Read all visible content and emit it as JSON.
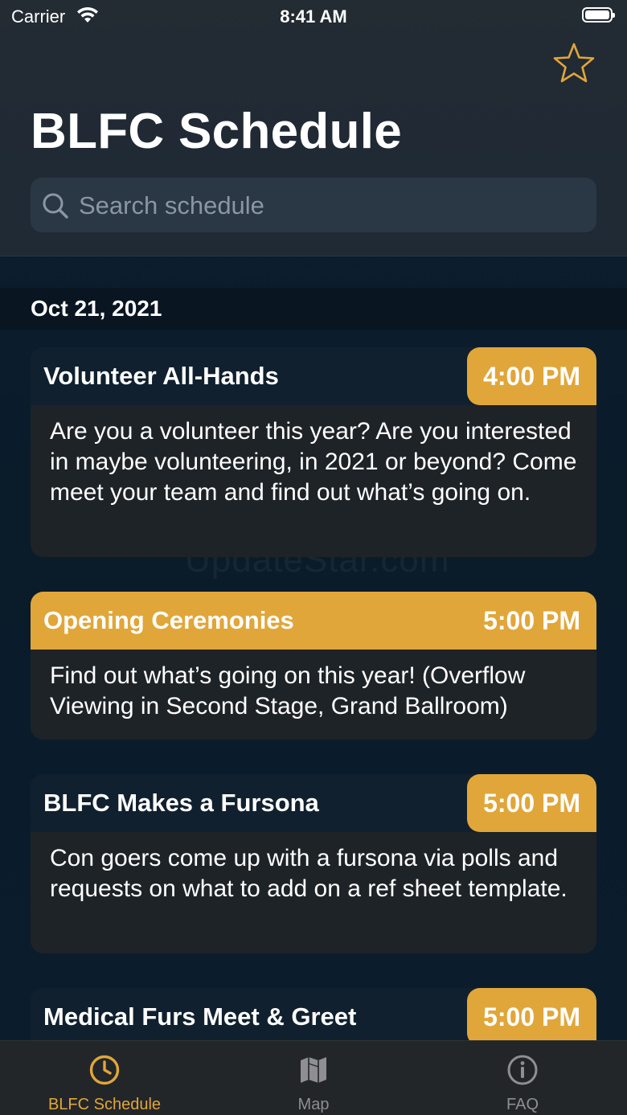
{
  "status_bar": {
    "carrier": "Carrier",
    "time": "8:41 AM"
  },
  "header": {
    "title": "BLFC Schedule",
    "search_placeholder": "Search schedule"
  },
  "section": {
    "date": "Oct 21, 2021"
  },
  "events": [
    {
      "title": "Volunteer All-Hands",
      "time": "4:00 PM",
      "highlight": false,
      "description": "Are you a volunteer this year? Are you interested in maybe volunteering, in 2021 or beyond? Come meet your team and find out what’s going on."
    },
    {
      "title": "Opening Ceremonies",
      "time": "5:00 PM",
      "highlight": true,
      "description": "Find out what’s going on this year! (Overflow Viewing in Second Stage, Grand Ballroom)"
    },
    {
      "title": "BLFC Makes a Fursona",
      "time": "5:00 PM",
      "highlight": false,
      "description": "Con goers come up with a fursona via polls and requests on what to add on a ref sheet template."
    },
    {
      "title": "Medical Furs Meet & Greet",
      "time": "5:00 PM",
      "highlight": false,
      "description": ""
    }
  ],
  "watermark": "UpdateStar.com",
  "tabs": [
    {
      "label": "BLFC Schedule",
      "icon": "clock-icon",
      "active": true
    },
    {
      "label": "Map",
      "icon": "map-icon",
      "active": false
    },
    {
      "label": "FAQ",
      "icon": "info-icon",
      "active": false
    }
  ],
  "colors": {
    "accent": "#e1a63a",
    "card_header": "#11202e",
    "card_body": "#1e2328",
    "tab_inactive": "#8e8e93"
  }
}
